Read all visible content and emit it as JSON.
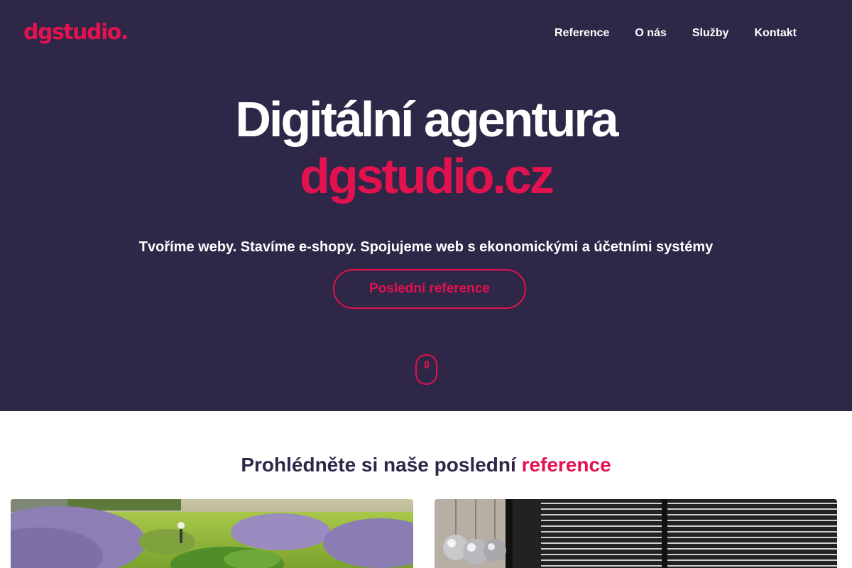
{
  "header": {
    "logo": "dgstudio.",
    "nav": [
      {
        "label": "Reference"
      },
      {
        "label": "O nás"
      },
      {
        "label": "Služby"
      },
      {
        "label": "Kontakt"
      }
    ]
  },
  "hero": {
    "title": "Digitální agentura",
    "brand": "dgstudio.cz",
    "tagline": "Tvoříme weby. Stavíme e-shopy. Spojujeme web s ekonomickými a účetními systémy",
    "cta_label": "Poslední reference",
    "scroll_icon": "mouse-scroll-icon"
  },
  "references": {
    "title_prefix": "Prohlédněte si naše poslední",
    "title_accent": "reference",
    "cards": [
      {
        "image": "garden-lavender-photo"
      },
      {
        "image": "interior-pendant-lamps-photo"
      }
    ]
  },
  "colors": {
    "hero_bg": "#2e2747",
    "accent": "#e3124f",
    "text_light": "#ffffff",
    "text_dark": "#2e2747"
  }
}
